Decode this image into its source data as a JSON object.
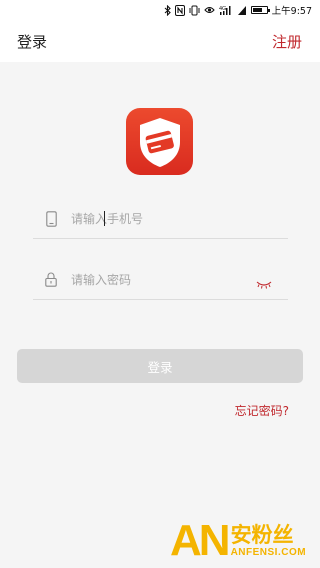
{
  "status_bar": {
    "time": "上午9:57",
    "icons": [
      "bluetooth-icon",
      "nfc-icon",
      "vibrate-icon",
      "eye-comfort-icon",
      "4g-signal-icon",
      "signal-icon",
      "battery-icon"
    ],
    "network_label": "4G",
    "battery_level": 0.7
  },
  "nav": {
    "title": "登录",
    "register_label": "注册"
  },
  "form": {
    "phone_placeholder": "请输入手机号",
    "password_placeholder": "请输入密码",
    "login_label": "登录",
    "forgot_label": "忘记密码?"
  },
  "watermark": {
    "brand_mark": "AN",
    "brand_cn": "安粉丝",
    "brand_en": "ANFENSI.COM"
  },
  "colors": {
    "accent": "#c0282d",
    "logo": "#e33a26",
    "button_disabled": "#d6d6d6",
    "watermark": "#f4b400"
  }
}
